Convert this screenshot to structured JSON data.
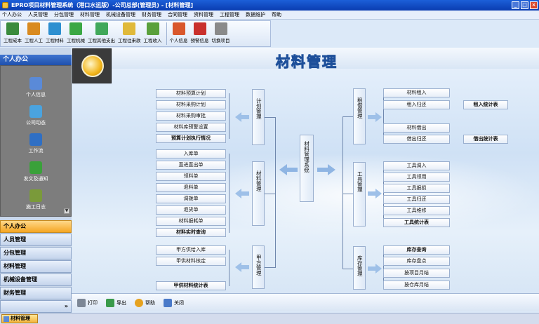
{
  "window": {
    "title": "EPRO项目材料管理系统（港口水运版）-公司总部(管理员) - [材料管理]",
    "buttons": [
      "_",
      "□",
      "×"
    ]
  },
  "menu": [
    "个人办公",
    "人员管理",
    "分包管理",
    "材料管理",
    "机械设备管理",
    "财务管理",
    "合同管理",
    "资料管理",
    "工程管理",
    "数据维护",
    "帮助"
  ],
  "toolbar": [
    {
      "label": "工程成本",
      "color": "#3a8b3c"
    },
    {
      "label": "工程人工",
      "color": "#d98a1f"
    },
    {
      "label": "工程材料",
      "color": "#2d8fd0"
    },
    {
      "label": "工程机械",
      "color": "#3ba844"
    },
    {
      "label": "工程其他支出",
      "color": "#41a85a"
    },
    {
      "label": "工程往来款",
      "color": "#e0b93a"
    },
    {
      "label": "工程收入",
      "color": "#5aa03b"
    },
    {
      "label": "个人信息",
      "color": "#d9572b"
    },
    {
      "label": "预警信息",
      "color": "#c9302c"
    },
    {
      "label": "切换项目",
      "color": "#8a8a8a"
    }
  ],
  "left_panel": {
    "header": "个人办公",
    "items": [
      {
        "label": "个人信息",
        "icon": "person-info-icon",
        "color": "#5a8ad8"
      },
      {
        "label": "公司动态",
        "icon": "news-icon",
        "color": "#4aa3df"
      },
      {
        "label": "工作流",
        "icon": "workflow-icon",
        "color": "#2f6fc4"
      },
      {
        "label": "发文及通知",
        "icon": "notice-icon",
        "color": "#3aa13a"
      },
      {
        "label": "施工日志",
        "icon": "diary-icon",
        "color": "#7a9a3a"
      }
    ],
    "nav": [
      "个人办公",
      "人员管理",
      "分包管理",
      "材料管理",
      "机械设备管理",
      "财务管理"
    ],
    "active_nav": 0,
    "more": "»"
  },
  "main": {
    "title": "材料管理",
    "center_label": "材料管理系统",
    "plan": {
      "label": "计划管理",
      "buttons": [
        "材料预算计划",
        "材料采购计划",
        "材料采购审批",
        "材料库预警设置",
        "预算计划执行情况"
      ]
    },
    "material": {
      "label": "材料管理",
      "buttons": [
        "入库单",
        "直进直出单",
        "领料单",
        "退料单",
        "调拨单",
        "退货单",
        "材料报耗单",
        "材料实时查询"
      ]
    },
    "party_a": {
      "label": "甲方管理",
      "buttons": [
        "甲方供给入库",
        "甲供材料核定",
        "甲供材料统计表"
      ]
    },
    "lease": {
      "label": "租借管理",
      "buttons": [
        "材料租入",
        "租入归还",
        "材料借出",
        "借出归还"
      ],
      "stats": [
        "租入统计表",
        "借出统计表"
      ]
    },
    "tools": {
      "label": "工具管理",
      "buttons": [
        "工具调入",
        "工具领用",
        "工具报损",
        "工具归还",
        "工具维修",
        "工具统计表"
      ]
    },
    "stock": {
      "label": "库存管理",
      "buttons": [
        "库存查询",
        "库存盘点",
        "按项目月结",
        "按仓库月结"
      ]
    }
  },
  "bottombar": [
    {
      "label": "打印",
      "icon": "print-icon"
    },
    {
      "label": "导出",
      "icon": "export-icon"
    },
    {
      "label": "帮助",
      "icon": "help-icon"
    },
    {
      "label": "关闭",
      "icon": "close-icon"
    }
  ],
  "statusbar": {
    "task": "材料管理"
  }
}
